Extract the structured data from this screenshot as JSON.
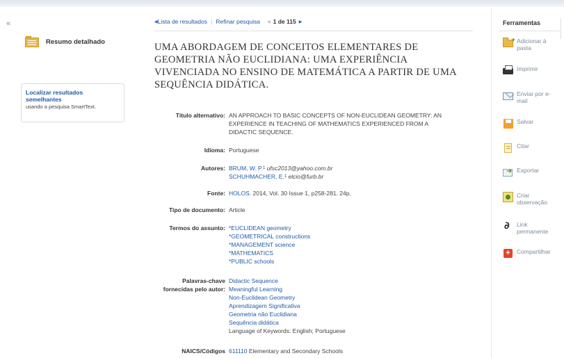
{
  "sidebar": {
    "detailed_summary": "Resumo detalhado",
    "similar_link": "Localizar resultados semelhantes",
    "similar_sub": "usando a pesquisa SmartText."
  },
  "nav": {
    "results_list": "Lista de resultados",
    "refine": "Refinar pesquisa",
    "count": "1 de 115"
  },
  "record": {
    "title": "UMA ABORDAGEM DE CONCEITOS ELEMENTARES DE GEOMETRIA NÃO EUCLIDIANA: UMA EXPERIÊNCIA VIVENCIADA NO ENSINO DE MATEMÁTICA A PARTIR DE UMA SEQUÊNCIA DIDÁTICA.",
    "labels": {
      "alt_title": "Título alternativo:",
      "language": "Idioma:",
      "authors": "Autores:",
      "source": "Fonte:",
      "doc_type": "Tipo de documento:",
      "subjects": "Termos do assunto:",
      "keywords": "Palavras-chave fornecidas pelo autor:",
      "naics": "NAICS/Códigos"
    },
    "alt_title_lines": [
      "AN APPROACH TO BASIC CONCEPTS OF NON-EUCLIDEAN GEOMETRY: AN",
      "EXPERIENCE IN TEACHING OF MATHEMATICS EXPERIENCED FROM A",
      "DIDACTIC SEQUENCE."
    ],
    "language": "Portuguese",
    "authors": [
      {
        "name": "BRUM, W. P.",
        "sup": "1",
        "email": "ufsc2013@yahoo.com.br"
      },
      {
        "name": "SCHUHMACHER, E.",
        "sup": "1",
        "email": "elcio@furb.br"
      }
    ],
    "source_link": "HOLOS.",
    "source_rest": "2014, Vol. 30 Issue 1, p258-281. 24p.",
    "doc_type": "Article",
    "subjects": [
      "*EUCLIDEAN geometry",
      "*GEOMETRICAL constructions",
      "*MANAGEMENT science",
      "*MATHEMATICS",
      "*PUBLIC schools"
    ],
    "keywords": [
      "Didactic Sequence",
      "Meaningful Learning",
      "Non-Euclidean Geometry",
      "Aprendizagem Significativa",
      "Geometria não Euclidiana",
      "Sequência didática"
    ],
    "keywords_language": "Language of Keywords: English; Portuguese",
    "naics_code": "611110",
    "naics_desc": "Elementary and Secondary Schools"
  },
  "tools": {
    "title": "Ferramentas",
    "items": [
      {
        "label": "Adicionar à pasta",
        "icon": "add-to-folder-icon"
      },
      {
        "label": "Imprimir",
        "icon": "printer-icon"
      },
      {
        "label": "Enviar por e-mail",
        "icon": "email-icon"
      },
      {
        "label": "Salvar",
        "icon": "save-icon"
      },
      {
        "label": "Citar",
        "icon": "cite-icon"
      },
      {
        "label": "Exportar",
        "icon": "export-icon"
      },
      {
        "label": "Criar observação",
        "icon": "note-icon"
      },
      {
        "label": "Link permanente",
        "icon": "link-icon"
      },
      {
        "label": "Compartilhar",
        "icon": "share-icon"
      }
    ]
  },
  "colors": {
    "link": "#1f5aa8",
    "tool_text": "#7b8a9c",
    "folder": "#e8b84a"
  }
}
